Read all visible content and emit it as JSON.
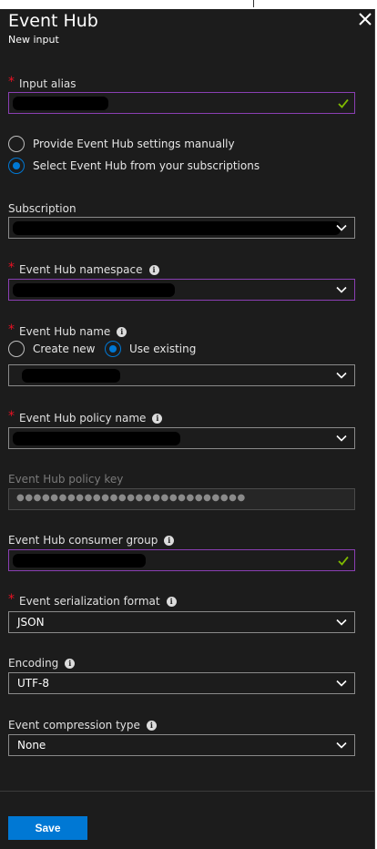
{
  "header": {
    "title": "Event Hub",
    "subtitle": "New input"
  },
  "form": {
    "input_alias": {
      "label": "Input alias"
    },
    "source_mode": {
      "manual_label": "Provide Event Hub settings manually",
      "subscriptions_label": "Select Event Hub from your subscriptions",
      "selected": "subscriptions"
    },
    "subscription": {
      "label": "Subscription"
    },
    "namespace": {
      "label": "Event Hub namespace"
    },
    "hub_name": {
      "label": "Event Hub name",
      "create_new_label": "Create new",
      "use_existing_label": "Use existing",
      "selected": "use_existing"
    },
    "policy_name": {
      "label": "Event Hub policy name"
    },
    "policy_key": {
      "label": "Event Hub policy key",
      "value": "●●●●●●●●●●●●●●●●●●●●●●●●●●●"
    },
    "consumer_group": {
      "label": "Event Hub consumer group"
    },
    "serialization": {
      "label": "Event serialization format",
      "value": "JSON"
    },
    "encoding": {
      "label": "Encoding",
      "value": "UTF-8"
    },
    "compression": {
      "label": "Event compression type",
      "value": "None"
    }
  },
  "footer": {
    "save_label": "Save"
  },
  "colors": {
    "accent": "#0078d4",
    "required": "#e81123",
    "valid": "#7fba00",
    "focus_border": "#8a3fb3",
    "panel_bg": "#1c1c1c"
  },
  "icons": [
    "close-icon",
    "info-icon",
    "chevron-down-icon",
    "checkmark-icon"
  ]
}
